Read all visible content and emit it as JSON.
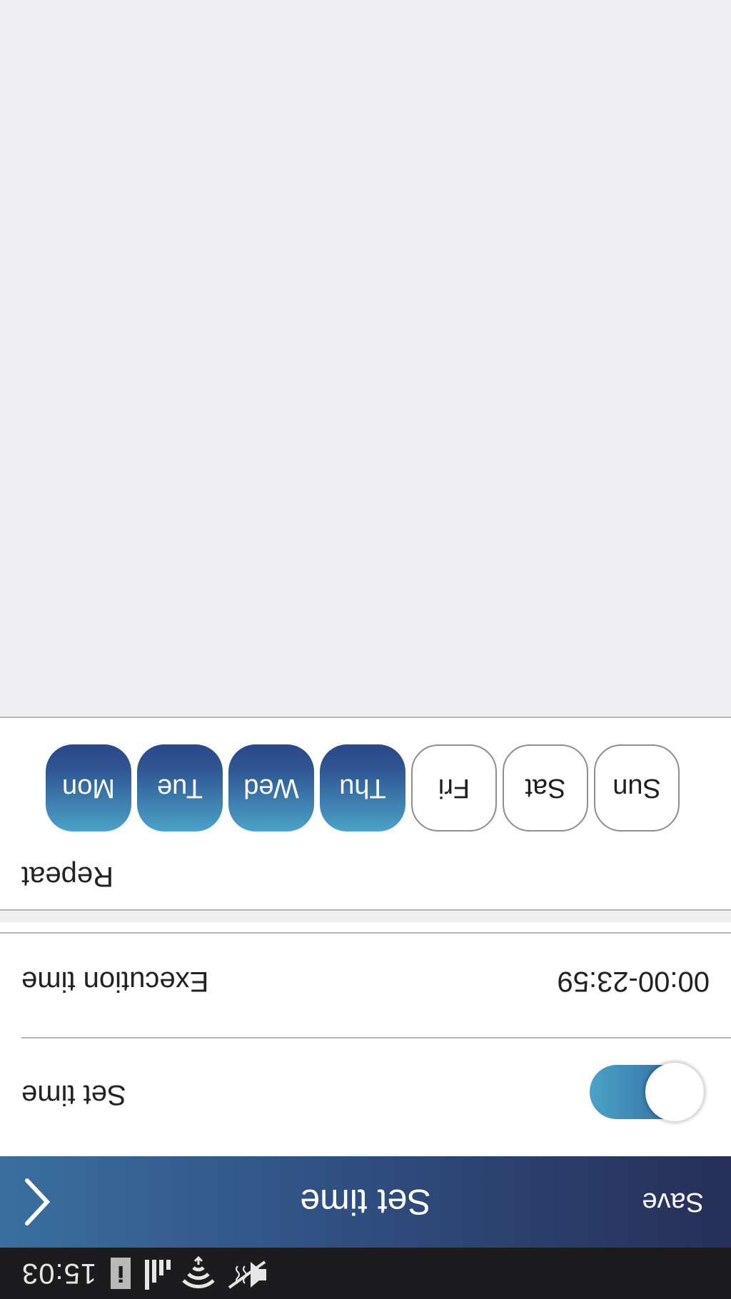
{
  "status_bar": {
    "time": "15:03",
    "icons": [
      "info-icon",
      "signal-icon",
      "wifi-icon",
      "mute-icon"
    ]
  },
  "app_bar": {
    "title": "Set time",
    "save_label": "Save",
    "back_icon": "chevron-left-icon"
  },
  "settings": {
    "set_time": {
      "label": "Set time",
      "enabled": true
    },
    "execution_time": {
      "label": "Execution time",
      "value": "00:00-23:59"
    }
  },
  "repeat": {
    "label": "Repeat",
    "days": [
      {
        "label": "Mon",
        "selected": true
      },
      {
        "label": "Tue",
        "selected": true
      },
      {
        "label": "Wed",
        "selected": true
      },
      {
        "label": "Thu",
        "selected": true
      },
      {
        "label": "Fri",
        "selected": false
      },
      {
        "label": "Sat",
        "selected": false
      },
      {
        "label": "Sun",
        "selected": false
      }
    ]
  },
  "colors": {
    "accent_dark": "#2c4789",
    "accent_light": "#4aa3c8",
    "background": "#efeff1",
    "status_bar": "#1c1c1e"
  }
}
